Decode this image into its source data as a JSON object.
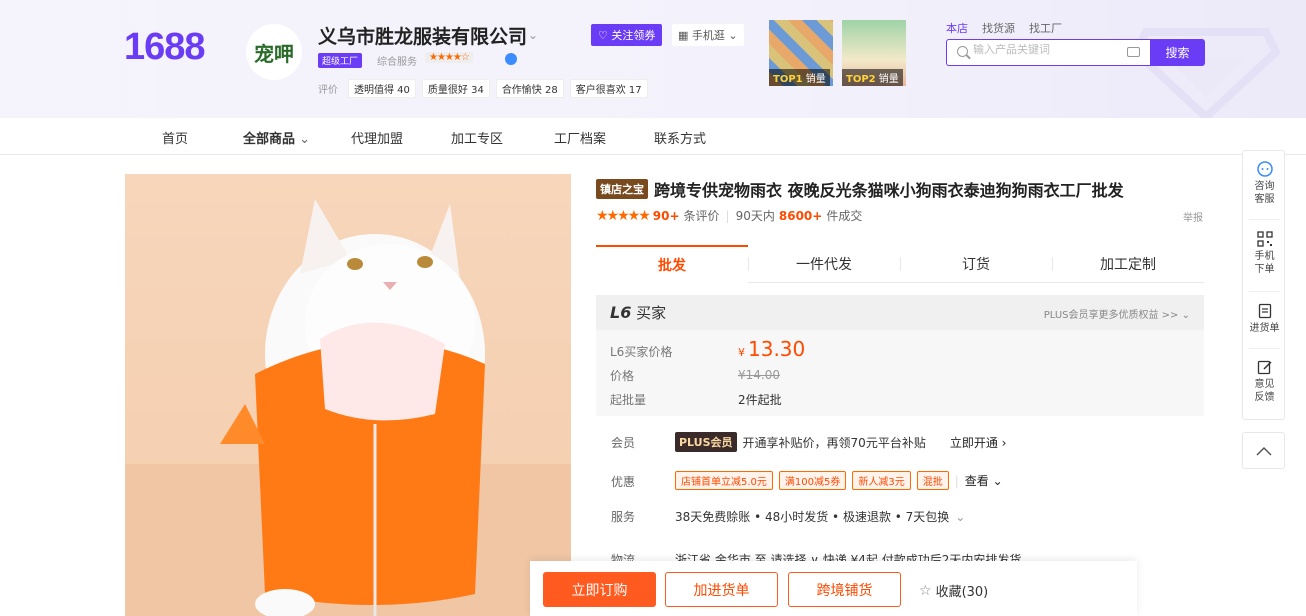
{
  "header": {
    "logo": "1688",
    "shop_logo_text": "宠呷",
    "shop_name": "义乌市胜龙服装有限公司",
    "badge": "超级工厂",
    "service_label": "综合服务",
    "service_stars": "★★★★☆",
    "eval_label": "评价",
    "eval_tags": [
      "透明值得 40",
      "质量很好 34",
      "合作愉快 28",
      "客户很喜欢 17"
    ],
    "follow_label": "关注领券",
    "mobile_label": "手机逛",
    "top_items": [
      {
        "label_rank": "TOP1",
        "label_text": "销量"
      },
      {
        "label_rank": "TOP2",
        "label_text": "销量"
      }
    ],
    "search_tabs": [
      "本店",
      "找货源",
      "找工厂"
    ],
    "search_placeholder": "输入产品关键词",
    "search_button": "搜索"
  },
  "nav": [
    "首页",
    "全部商品",
    "代理加盟",
    "加工专区",
    "工厂档案",
    "联系方式"
  ],
  "product": {
    "tag": "镇店之宝",
    "title": "跨境专供宠物雨衣 夜晚反光条猫咪小狗雨衣泰迪狗狗雨衣工厂批发",
    "rating_stars": "★★★★★",
    "review_count": "90+",
    "review_label": "条评价",
    "period_label": "90天内",
    "deal_count": "8600+",
    "deal_label": "件成交",
    "report_label": "举报"
  },
  "tabs": [
    "批发",
    "一件代发",
    "订货",
    "加工定制"
  ],
  "member_box": {
    "level": "L6",
    "level_text": "买家",
    "plus_text": "PLUS会员享更多优质权益 >>"
  },
  "pricing": {
    "l6_label": "L6买家价格",
    "currency": "¥",
    "l6_price": "13.30",
    "price_label": "价格",
    "original_price": "¥14.00",
    "min_label": "起批量",
    "min_value": "2件起批"
  },
  "details": {
    "member_label": "会员",
    "plus_badge": "PLUS会员",
    "member_text": "开通享补贴价，再领70元平台补贴",
    "member_link": "立即开通",
    "discount_label": "优惠",
    "coupons": [
      "店铺首单立减5.0元",
      "满100减5券",
      "新人减3元",
      "混批"
    ],
    "view_label": "查看",
    "service_label": "服务",
    "service_text": "38天免费赊账 • 48小时发货 • 极速退款 • 7天包换",
    "logistics_label": "物流",
    "logistics_text": "浙江省 金华市 至 请选择 ∨ 快递 ¥4起 付款成功后2天内安排发货"
  },
  "actions": {
    "buy": "立即订购",
    "add": "加进货单",
    "cross": "跨境铺货",
    "fav": "收藏(30)"
  },
  "sidebar": [
    {
      "icon": "chat-icon",
      "label": "咨询客服"
    },
    {
      "icon": "qrcode-icon",
      "label": "手机下单"
    },
    {
      "icon": "list-icon",
      "label": "进货单"
    },
    {
      "icon": "edit-icon",
      "label": "意见反馈"
    }
  ],
  "colors": {
    "brand": "#6b3cf5",
    "accent": "#ff4a00"
  }
}
